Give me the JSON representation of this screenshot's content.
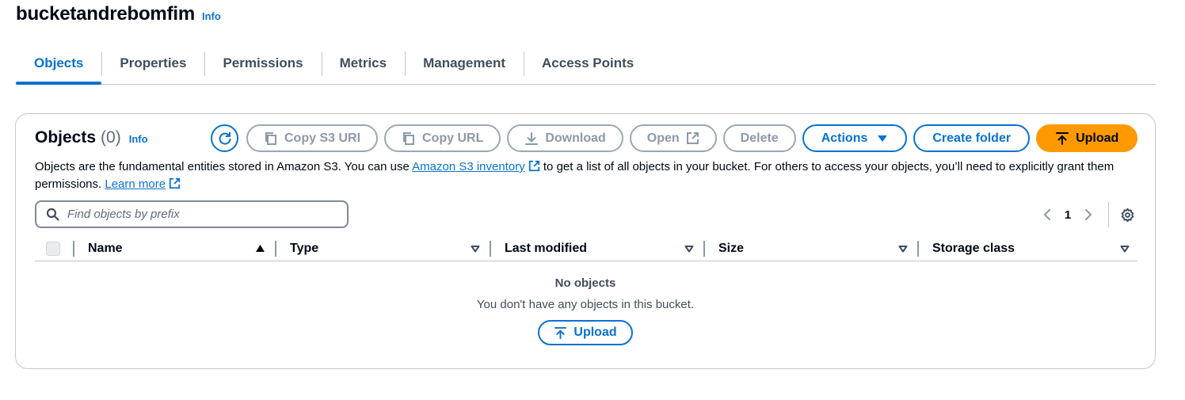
{
  "header": {
    "title": "bucketandrebomfim",
    "info": "Info"
  },
  "tabs": [
    {
      "label": "Objects",
      "active": true
    },
    {
      "label": "Properties",
      "active": false
    },
    {
      "label": "Permissions",
      "active": false
    },
    {
      "label": "Metrics",
      "active": false
    },
    {
      "label": "Management",
      "active": false
    },
    {
      "label": "Access Points",
      "active": false
    }
  ],
  "objects_panel": {
    "title": "Objects",
    "count": "(0)",
    "info": "Info",
    "toolbar": {
      "refresh_icon": "refresh-icon",
      "copy_s3_uri": "Copy S3 URI",
      "copy_url": "Copy URL",
      "download": "Download",
      "open": "Open",
      "delete": "Delete",
      "actions": "Actions",
      "create_folder": "Create folder",
      "upload": "Upload"
    },
    "description": {
      "part1": "Objects are the fundamental entities stored in Amazon S3. You can use ",
      "link1": "Amazon S3 inventory",
      "part2": " to get a list of all objects in your bucket. For others to access your objects, you’ll need to explicitly grant them permissions. ",
      "link2": "Learn more"
    },
    "search": {
      "placeholder": "Find objects by prefix",
      "value": ""
    },
    "pagination": {
      "current_page": "1"
    },
    "table": {
      "columns": [
        "Name",
        "Type",
        "Last modified",
        "Size",
        "Storage class"
      ]
    },
    "empty_state": {
      "title": "No objects",
      "message": "You don't have any objects in this bucket.",
      "upload": "Upload"
    }
  },
  "colors": {
    "accent": "#0972d3",
    "upload_button": "#ff9900",
    "disabled": "#8d99a8",
    "border": "#c6c6cd"
  }
}
